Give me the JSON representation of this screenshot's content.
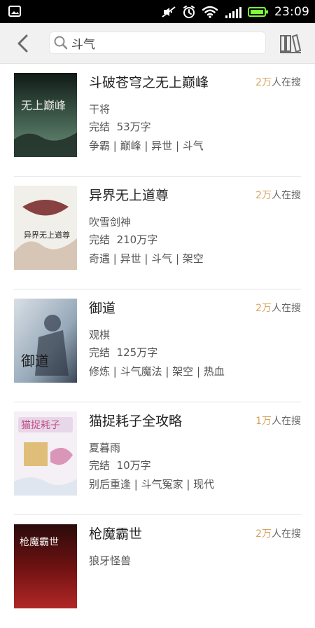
{
  "status_bar": {
    "time": "23:09",
    "icons": [
      "image-icon",
      "mute-icon",
      "alarm-icon",
      "wifi-icon",
      "signal-icon",
      "battery-icon"
    ]
  },
  "search": {
    "query": "斗气",
    "back_icon": "back-icon",
    "search_icon": "search-icon",
    "shelf_icon": "bookshelf-icon"
  },
  "results": [
    {
      "title": "斗破苍穹之无上巅峰",
      "hot_num": "2万",
      "hot_suffix": "人在搜",
      "author": "干将",
      "status": "完结",
      "words": "53万字",
      "tags": "争霸 | 巅峰 | 异世 | 斗气",
      "cover_text": "无上巅峰",
      "cover_colors": [
        "#1f2a24",
        "#3f5c4c",
        "#6c8f7a"
      ]
    },
    {
      "title": "异界无上道尊",
      "hot_num": "2万",
      "hot_suffix": "人在搜",
      "author": "吹雪剑神",
      "status": "完结",
      "words": "210万字",
      "tags": "奇遇 | 异世 | 斗气 | 架空",
      "cover_text": "异界无上道尊",
      "cover_colors": [
        "#f1efe9",
        "#d7c6b5",
        "#7a2e2e"
      ]
    },
    {
      "title": "御道",
      "hot_num": "2万",
      "hot_suffix": "人在搜",
      "author": "观棋",
      "status": "完结",
      "words": "125万字",
      "tags": "修炼 | 斗气魔法 | 架空 | 热血",
      "cover_text": "御道",
      "cover_colors": [
        "#d9dfe6",
        "#95a8b8",
        "#3b4656"
      ]
    },
    {
      "title": "猫捉耗子全攻略",
      "hot_num": "1万",
      "hot_suffix": "人在搜",
      "author": "夏暮雨",
      "status": "完结",
      "words": "10万字",
      "tags": "别后重逢 | 斗气冤家 | 现代",
      "cover_text": "猫捉耗子",
      "cover_colors": [
        "#f5f0f6",
        "#e7d7e8",
        "#c24d87"
      ]
    },
    {
      "title": "枪魔霸世",
      "hot_num": "2万",
      "hot_suffix": "人在搜",
      "author": "狼牙怪兽",
      "status": "",
      "words": "",
      "tags": "",
      "cover_text": "枪魔霸世",
      "cover_colors": [
        "#2b0b0b",
        "#6d1111",
        "#b22727"
      ]
    }
  ]
}
